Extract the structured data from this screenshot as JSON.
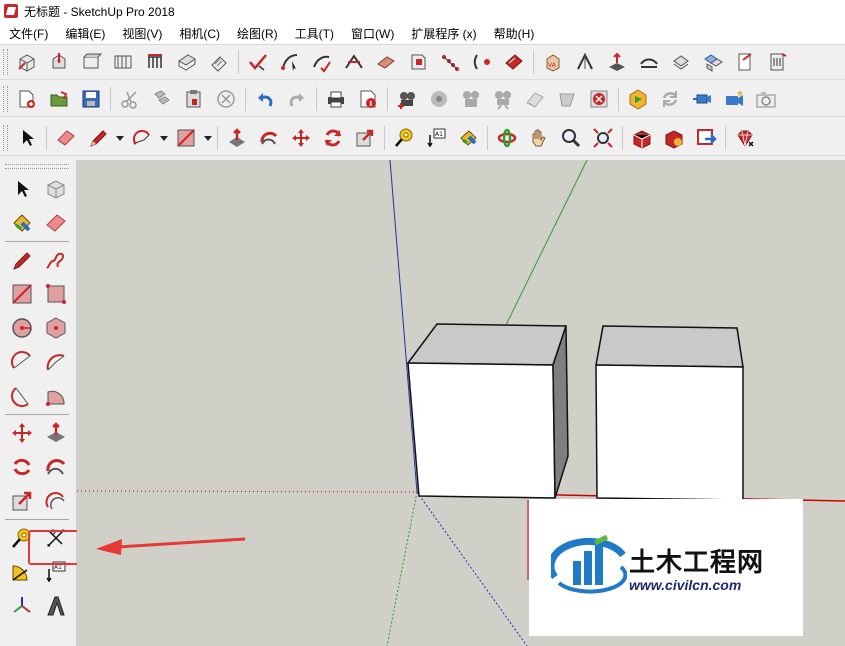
{
  "window": {
    "title": "无标题 - SketchUp Pro 2018"
  },
  "menu": [
    "文件(F)",
    "编辑(E)",
    "视图(V)",
    "相机(C)",
    "绘图(R)",
    "工具(T)",
    "窗口(W)",
    "扩展程序 (x)",
    "帮助(H)"
  ],
  "toolbar_row1": [
    "iso-view-icon",
    "top-view-icon",
    "front-view-icon",
    "right-view-icon",
    "back-view-icon",
    "left-view-icon",
    "bottom-view-icon",
    "x-ray-icon",
    "wireframe-icon",
    "hidden-line-icon",
    "shaded-icon",
    "textured-icon",
    "monochrome-icon",
    "section-plane-icon",
    "section-fill-icon",
    "section-cut-icon",
    "display-section-icon",
    "sandbox-icon",
    "terrain-icon",
    "layers-icon",
    "outliner-icon",
    "components-icon",
    "warehouse-icon",
    "extension-icon"
  ],
  "toolbar_row2": [
    "new-file-icon",
    "open-file-icon",
    "save-icon",
    "cut-icon",
    "copy-icon",
    "paste-icon",
    "erase-icon",
    "undo-icon",
    "redo-icon",
    "print-icon",
    "model-info-icon",
    "camera-position-icon",
    "look-around-icon",
    "walk-icon",
    "tour-icon",
    "shadow-icon",
    "fog-icon",
    "stop-icon",
    "style-icon",
    "sync-icon",
    "animation-icon",
    "scene-icon",
    "photo-icon"
  ],
  "toolbar_row3": [
    "select-icon",
    "eraser-icon",
    "pencil-icon",
    "arc-icon",
    "rectangle-icon",
    "push-pull-icon",
    "follow-me-icon",
    "move-icon",
    "rotate-icon",
    "scale-icon",
    "tape-measure-icon",
    "text-icon",
    "paint-bucket-icon",
    "orbit-icon",
    "pan-icon",
    "zoom-icon",
    "zoom-extents-icon",
    "warehouse-3d-icon",
    "share-model-icon",
    "ruby-console-icon"
  ],
  "left_toolbar": [
    [
      "select-icon",
      "component-icon"
    ],
    [
      "paint-bucket-icon",
      "eraser-icon"
    ],
    [
      "line-icon",
      "freehand-icon"
    ],
    [
      "rectangle-icon",
      "rotated-rectangle-icon"
    ],
    [
      "circle-icon",
      "polygon-icon"
    ],
    [
      "arc-icon",
      "two-point-arc-icon"
    ],
    [
      "three-point-arc-icon",
      "pie-icon"
    ],
    [
      "move-icon",
      "push-pull-icon"
    ],
    [
      "rotate-icon",
      "follow-me-icon"
    ],
    [
      "scale-icon",
      "offset-icon"
    ],
    [
      "tape-measure-icon",
      "dimension-icon"
    ],
    [
      "protractor-icon",
      "text-icon"
    ],
    [
      "axes-icon",
      "3d-text-icon"
    ]
  ],
  "watermark": {
    "name": "土木工程网",
    "url": "www.civilcn.com"
  },
  "colors": {
    "accent_red": "#e53935",
    "axis_red": "#cc0000",
    "axis_green": "#2e9e2e",
    "axis_blue": "#2233aa",
    "viewport_bg": "#d0cfc8"
  }
}
